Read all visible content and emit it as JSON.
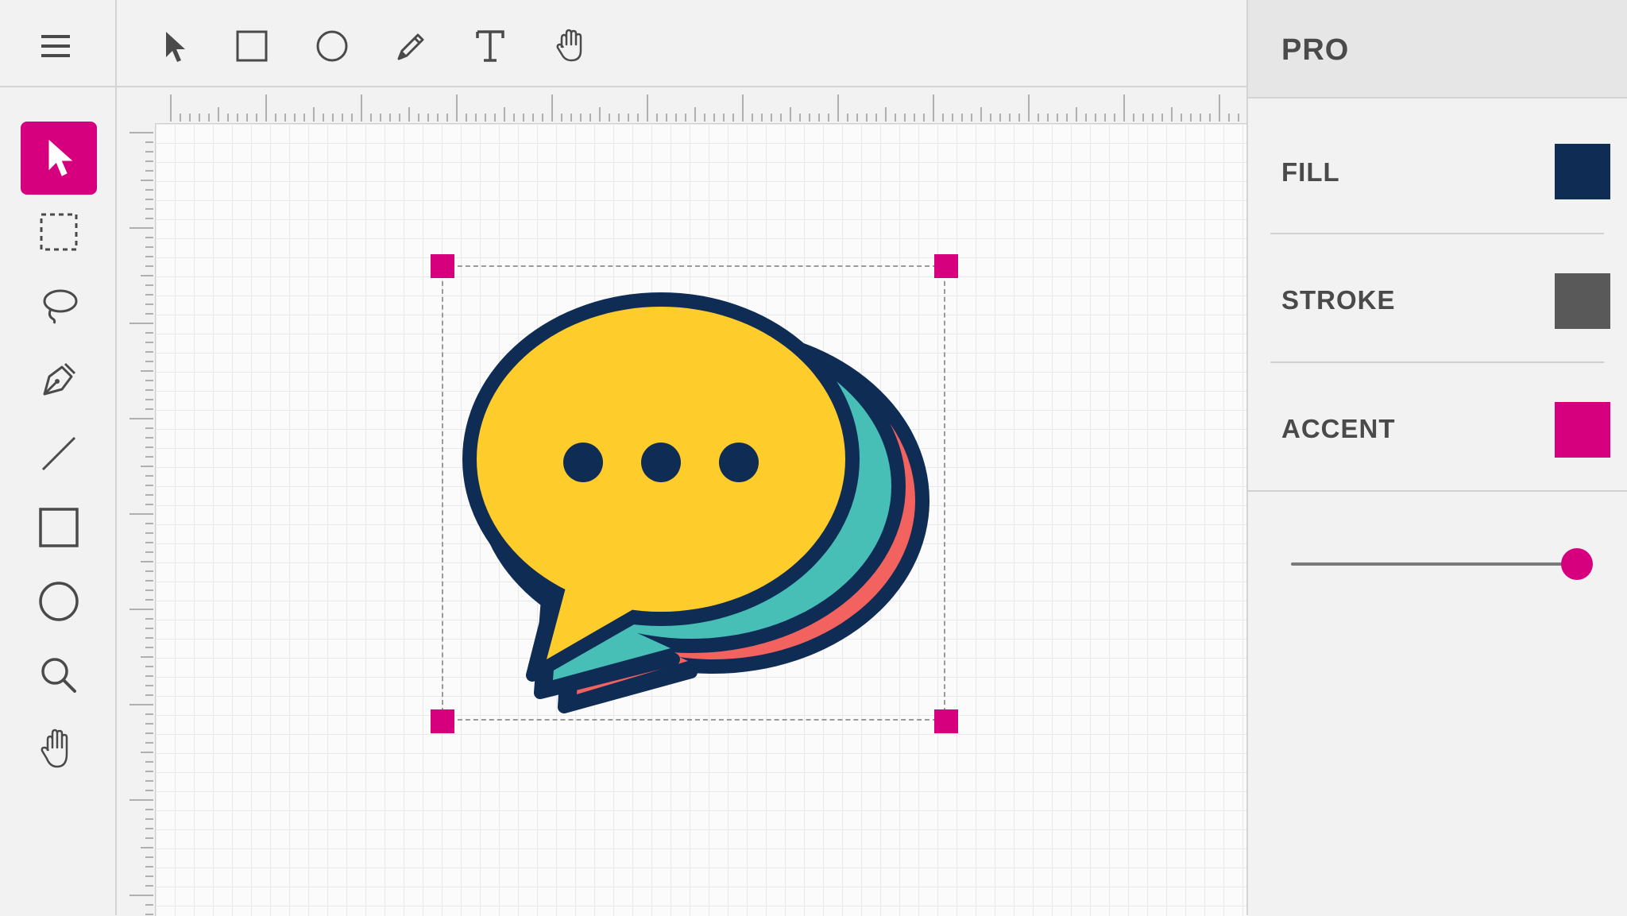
{
  "panel": {
    "title": "PRO",
    "properties": [
      {
        "label": "FILL",
        "color": "#0f2c55"
      },
      {
        "label": "STROKE",
        "color": "#595959"
      },
      {
        "label": "ACCENT",
        "color": "#d6007e"
      }
    ],
    "slider_value": 1.0
  },
  "top_toolbar": {
    "tools": [
      "pointer-icon",
      "rectangle-icon",
      "ellipse-icon",
      "pencil-icon",
      "text-icon",
      "hand-icon"
    ]
  },
  "left_toolbar": {
    "tools": [
      "select-arrow-icon",
      "marquee-select-icon",
      "lasso-icon",
      "pen-tool-icon",
      "line-icon",
      "rectangle-icon",
      "ellipse-icon",
      "zoom-icon",
      "hand-icon"
    ],
    "active": "select-arrow-icon"
  },
  "colors": {
    "accent": "#d6007e",
    "navy": "#0f2c55",
    "yellow": "#ffcd2b",
    "teal": "#47bfb6",
    "coral": "#f2625f"
  }
}
